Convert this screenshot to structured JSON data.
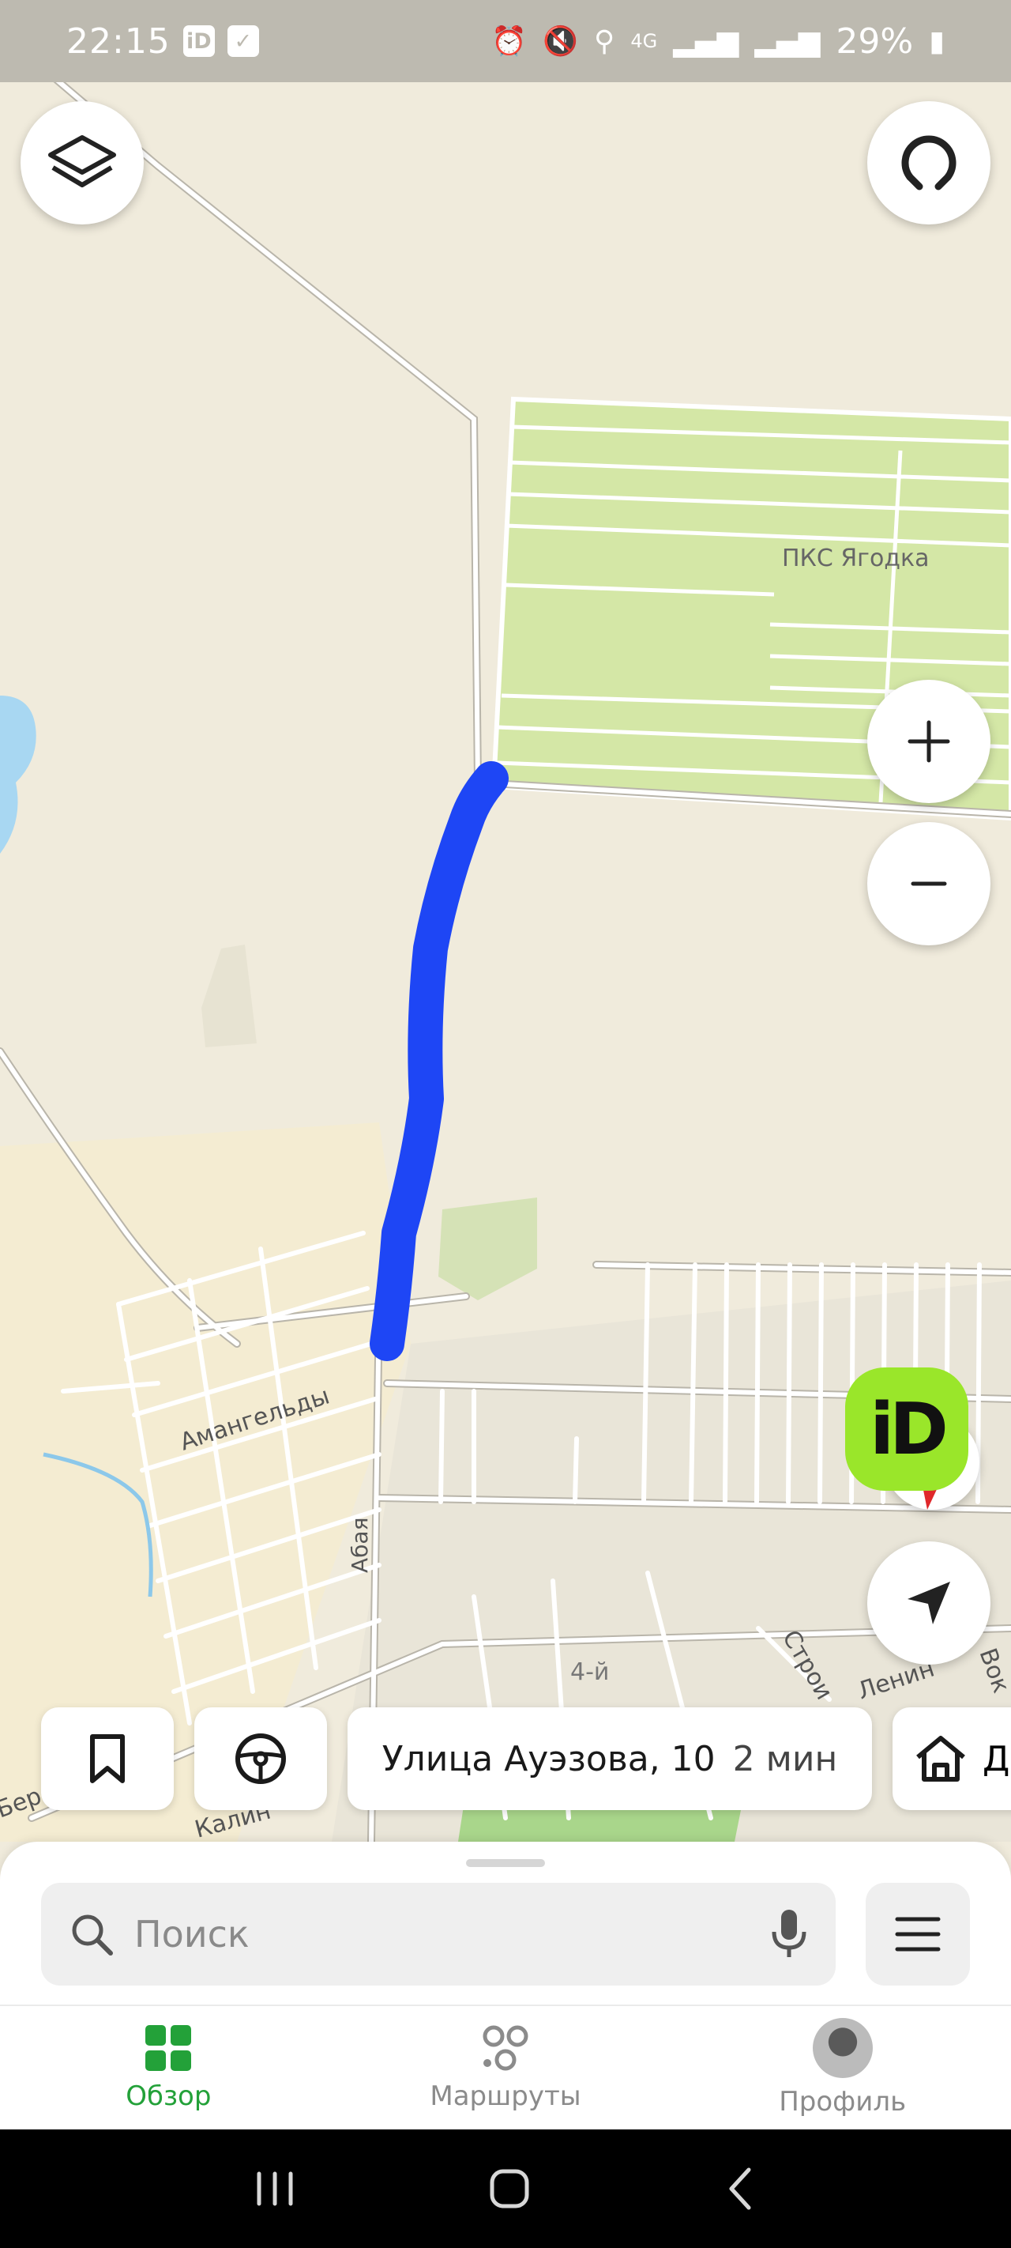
{
  "status_bar": {
    "time": "22:15",
    "app_badge": "iD",
    "network": "4G",
    "battery": "29%"
  },
  "map": {
    "labels": {
      "pks": "ПКС Ягодка",
      "amangeldy": "Амангельды",
      "abaya": "Абая",
      "district": "4-й",
      "stroi": "Строи",
      "lenina": "Ленин",
      "vok": "Вок",
      "kalin": "Калин",
      "bereg": "Берег"
    },
    "route_color": "#1e46f5"
  },
  "route_chip": {
    "destination": "Улица Ауэзова, 10",
    "eta": "2 мин"
  },
  "home_chip": {
    "label": "Д"
  },
  "search": {
    "placeholder": "Поиск"
  },
  "tabs": [
    {
      "label": "Обзор",
      "active": true
    },
    {
      "label": "Маршруты",
      "active": false
    },
    {
      "label": "Профиль",
      "active": false
    }
  ],
  "colors": {
    "accent": "#23a139",
    "id_logo": "#9ae62a"
  }
}
